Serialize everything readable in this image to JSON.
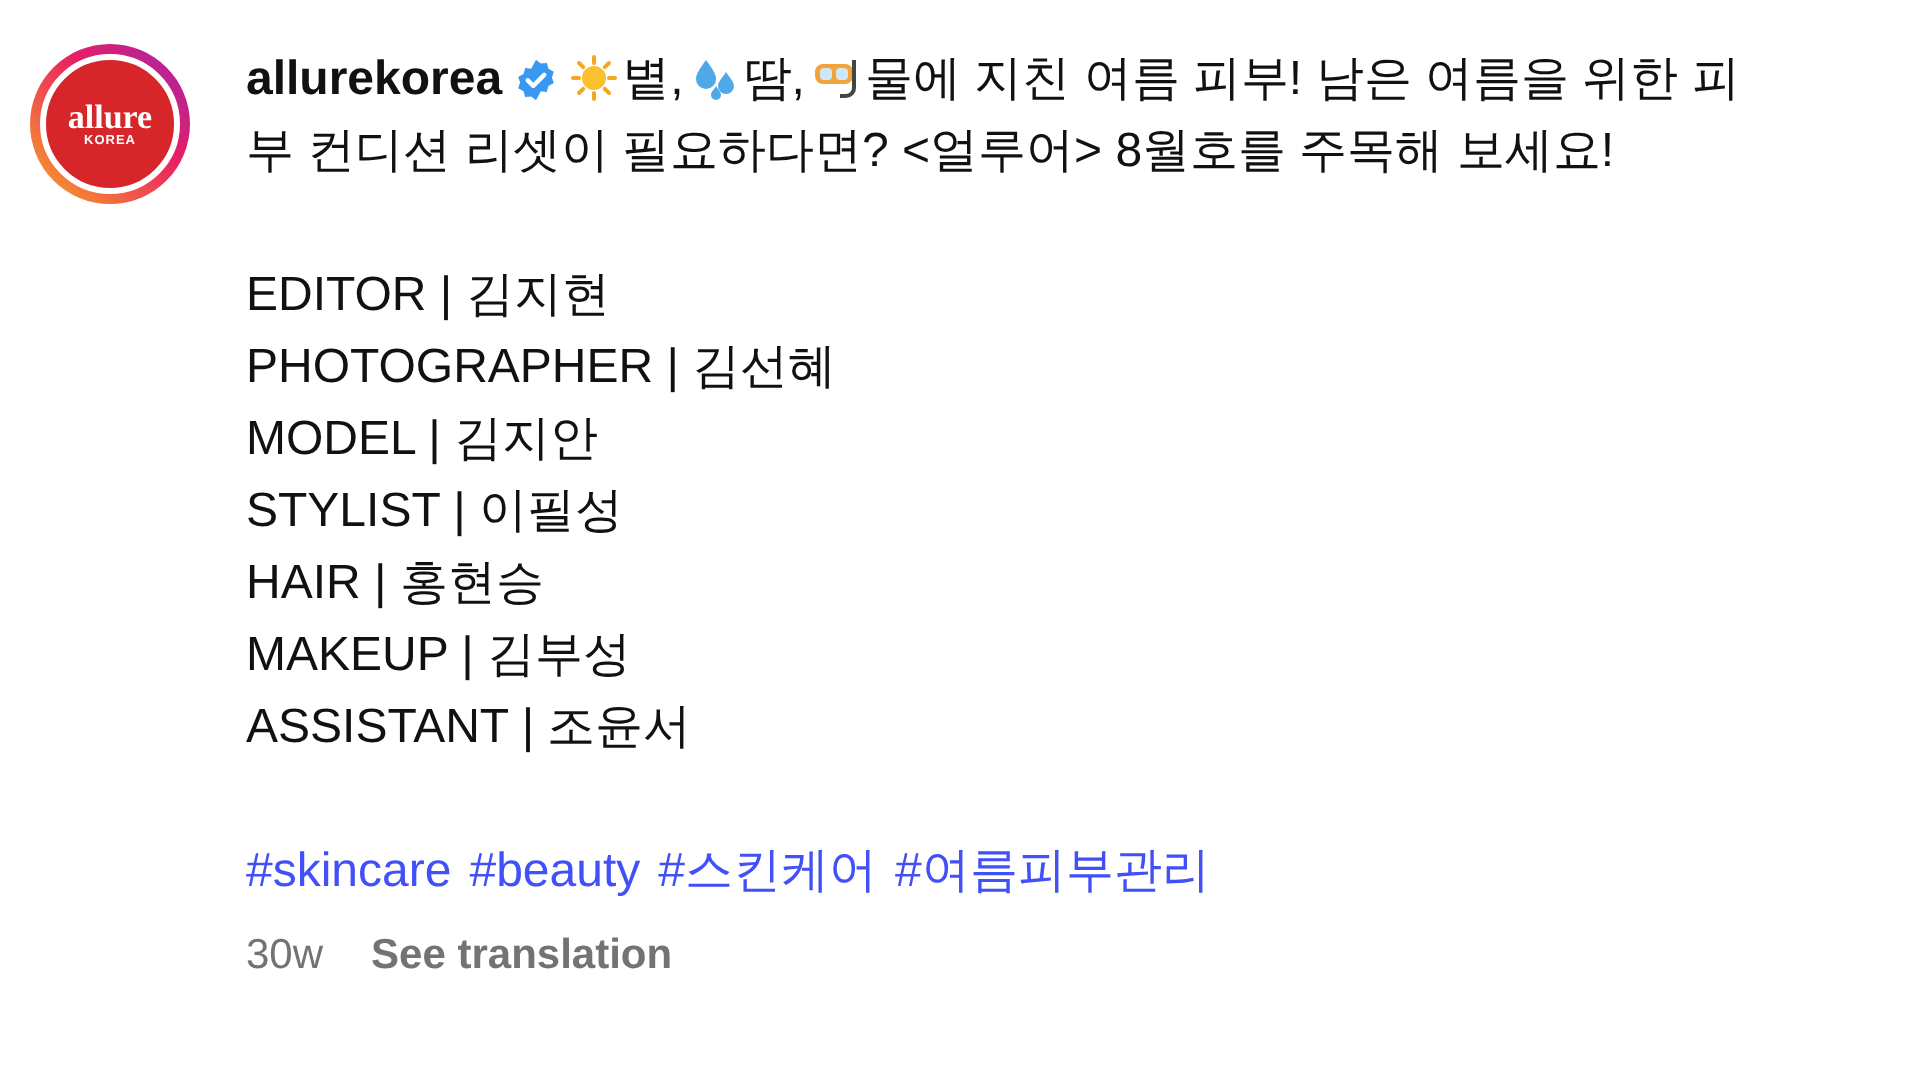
{
  "author": {
    "username": "allurekorea",
    "avatar": {
      "brand": "allure",
      "sub": "KOREA"
    },
    "verified": true
  },
  "caption": {
    "segments": [
      "볕,",
      "땀,",
      "물에 지친 여름 피부! 남은 여름을 위한 피"
    ],
    "continuation": "부 컨디션 리셋이 필요하다면? <얼루어> 8월호를 주목해 보세요!"
  },
  "credits": [
    "EDITOR | 김지현",
    "PHOTOGRAPHER | 김선혜",
    "MODEL | 김지안",
    "STYLIST | 이필성",
    "HAIR | 홍현승",
    "MAKEUP | 김부성",
    "ASSISTANT | 조윤서"
  ],
  "hashtags": [
    "#skincare",
    "#beauty",
    "#스킨케어",
    "#여름피부관리"
  ],
  "footer": {
    "time": "30w",
    "translate": "See translation"
  }
}
